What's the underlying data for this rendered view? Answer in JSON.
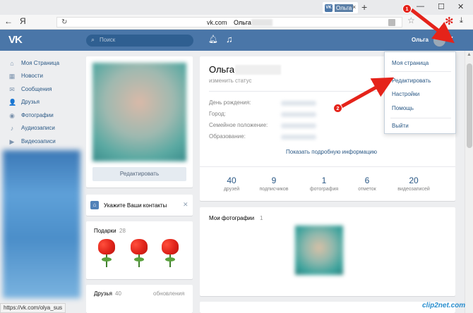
{
  "browser": {
    "tab_title": "Ольга",
    "tab_icon": "VK",
    "new_tab": "+",
    "window_controls": [
      "—",
      "☐",
      "✕"
    ],
    "back": "←",
    "yandex": "Я",
    "url": "vk.com",
    "page_title": "Ольга",
    "status_url": "https://vk.com/olya_sus"
  },
  "header": {
    "logo": "VK",
    "search_placeholder": "Поиск",
    "user_name": "Ольга"
  },
  "sidebar": {
    "items": [
      {
        "label": "Моя Страница",
        "icon": "home-icon",
        "glyph": "⌂"
      },
      {
        "label": "Новости",
        "icon": "news-icon",
        "glyph": "▦"
      },
      {
        "label": "Сообщения",
        "icon": "messages-icon",
        "glyph": "✉"
      },
      {
        "label": "Друзья",
        "icon": "friends-icon",
        "glyph": "👤"
      },
      {
        "label": "Фотографии",
        "icon": "photos-icon",
        "glyph": "◉"
      },
      {
        "label": "Аудиозаписи",
        "icon": "audio-icon",
        "glyph": "♪"
      },
      {
        "label": "Видеозаписи",
        "icon": "video-icon",
        "glyph": "▶"
      }
    ]
  },
  "left_column": {
    "edit_button": "Редактировать",
    "contacts_prompt": "Укажите Ваши контакты",
    "gifts_title": "Подарки",
    "gifts_count": "28",
    "friends_title": "Друзья",
    "friends_count": "40",
    "friends_updates": "обновления"
  },
  "profile": {
    "name": "Ольга",
    "status": "изменить статус",
    "info_labels": [
      "День рождения:",
      "Город:",
      "Семейное положение:",
      "Образование:"
    ],
    "more_info": "Показать подробную информацию",
    "stats": [
      {
        "value": "40",
        "label": "друзей"
      },
      {
        "value": "9",
        "label": "подписчиков"
      },
      {
        "value": "1",
        "label": "фотография"
      },
      {
        "value": "6",
        "label": "отметок"
      },
      {
        "value": "20",
        "label": "видеозаписей"
      }
    ],
    "photos_title": "Мои фотографии",
    "photos_count": "1"
  },
  "dropdown": {
    "items": [
      "Моя страница",
      "Редактировать",
      "Настройки",
      "Помощь",
      "Выйти"
    ]
  },
  "annotations": {
    "badge_1": "1",
    "badge_2": "2",
    "arrow_color": "#e5231a"
  },
  "watermark": "clip2net.com",
  "colors": {
    "vk_blue": "#4a76a8",
    "link": "#2a5885",
    "background": "#edeef0"
  }
}
